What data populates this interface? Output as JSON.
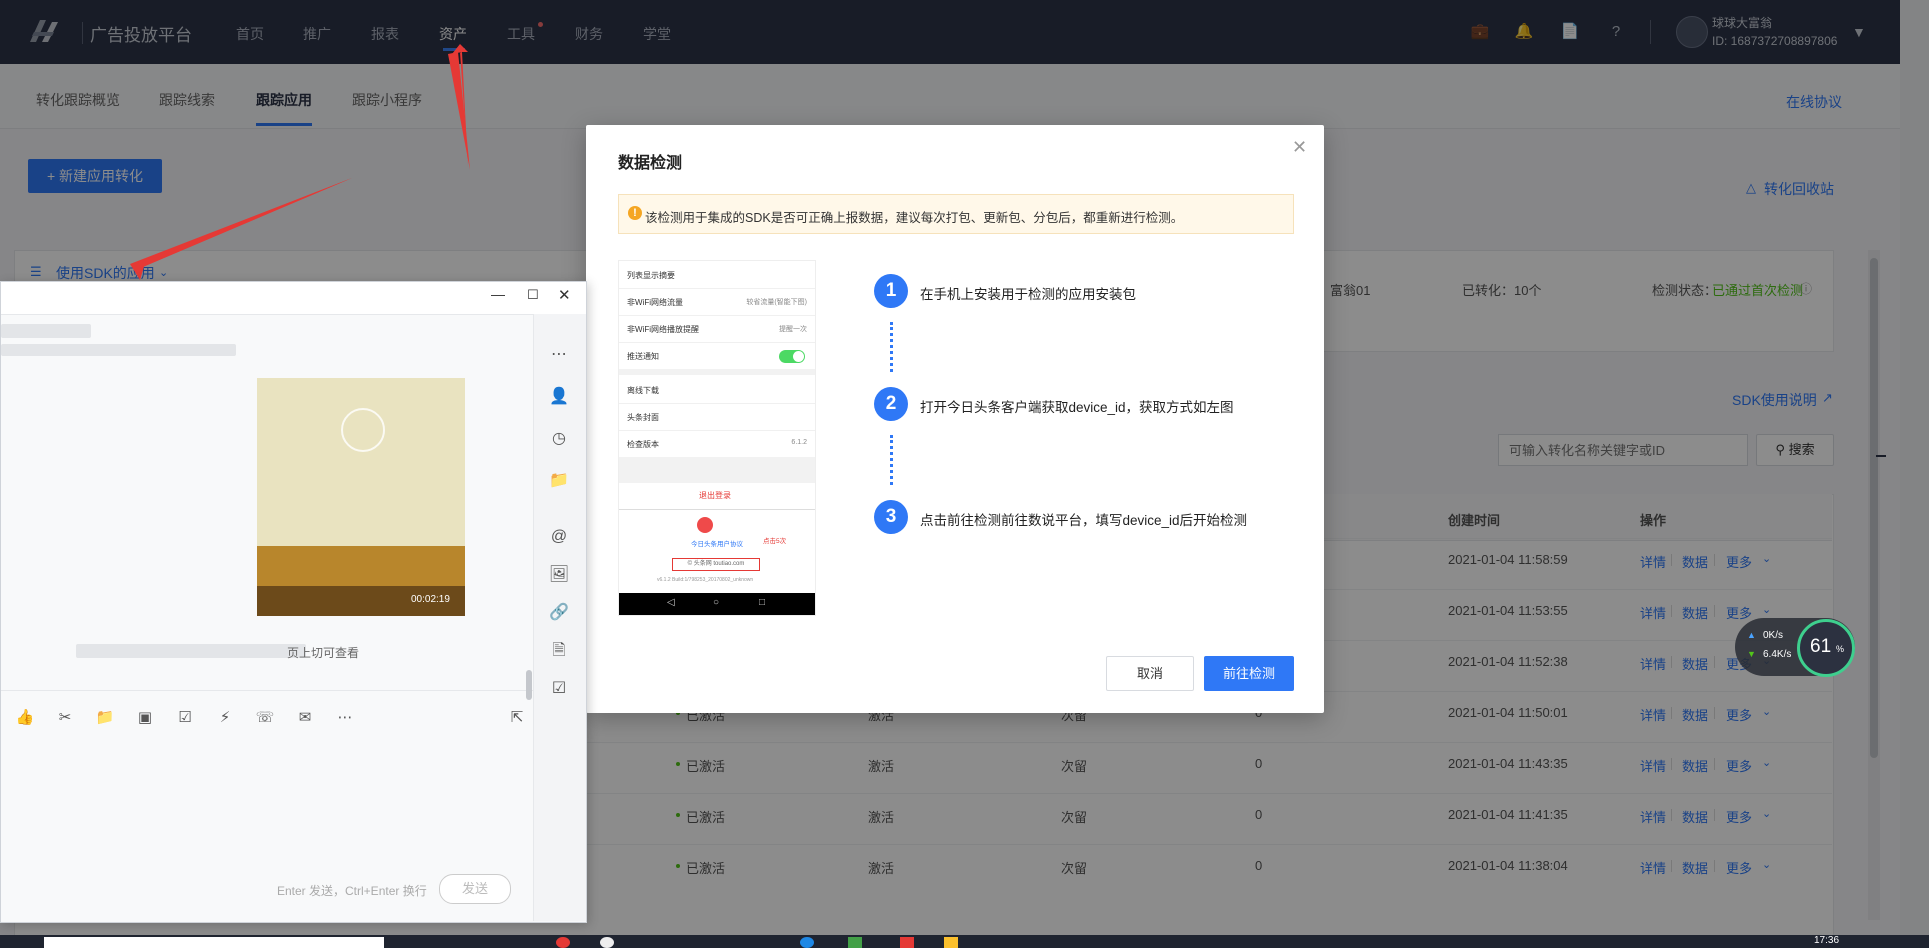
{
  "topnav": {
    "brand": "广告投放平台",
    "items": [
      "首页",
      "推广",
      "报表",
      "资产",
      "工具",
      "财务",
      "学堂"
    ],
    "active": "资产",
    "user": {
      "name": "球球大富翁",
      "id": "ID: 1687372708897806"
    }
  },
  "subnav": {
    "tabs": [
      "转化跟踪概览",
      "跟踪线索",
      "跟踪应用",
      "跟踪小程序"
    ],
    "active": "跟踪应用",
    "right_link": "在线协议"
  },
  "toolbar": {
    "new_button": "+ 新建应用转化",
    "recycle_link": "转化回收站",
    "sdk_dropdown": "使用SDK的应用"
  },
  "summary": {
    "creator": "富翁01",
    "converted": "已转化：10个",
    "status_label": "检测状态：",
    "status_value": "已通过首次检测"
  },
  "search": {
    "sdk_doc_link": "SDK使用说明",
    "placeholder": "可输入转化名称关键字或ID",
    "button": "搜索"
  },
  "table": {
    "headers": {
      "created": "创建时间",
      "ops": "操作"
    },
    "ops": [
      "详情",
      "数据",
      "更多"
    ],
    "rows": [
      {
        "status": "",
        "type": "",
        "freq": "",
        "count": "",
        "time": "2021-01-04 11:58:59"
      },
      {
        "status": "",
        "type": "",
        "freq": "",
        "count": "",
        "time": "2021-01-04 11:53:55"
      },
      {
        "status": "",
        "type": "",
        "freq": "",
        "count": "",
        "time": "2021-01-04 11:52:38"
      },
      {
        "status": "已激活",
        "type": "激活",
        "freq": "次留",
        "count": "0",
        "time": "2021-01-04 11:50:01"
      },
      {
        "status": "已激活",
        "type": "激活",
        "freq": "次留",
        "count": "0",
        "time": "2021-01-04 11:43:35"
      },
      {
        "status": "已激活",
        "type": "激活",
        "freq": "次留",
        "count": "0",
        "time": "2021-01-04 11:41:35"
      },
      {
        "status": "已激活",
        "type": "激活",
        "freq": "次留",
        "count": "0",
        "time": "2021-01-04 11:38:04"
      }
    ]
  },
  "modal": {
    "title": "数据检测",
    "notice": "该检测用于集成的SDK是否可正确上报数据，建议每次打包、更新包、分包后，都重新进行检测。",
    "steps": [
      {
        "num": "1",
        "text": "在手机上安装用于检测的应用安装包"
      },
      {
        "num": "2",
        "text": "打开今日头条客户端获取device_id，获取方式如左图"
      },
      {
        "num": "3",
        "text": "点击前往检测前往数说平台，填写device_id后开始检测"
      }
    ],
    "cancel": "取消",
    "confirm": "前往检测",
    "phone": {
      "rows": [
        {
          "label": "列表显示摘要",
          "value": ""
        },
        {
          "label": "非WiFi网络流量",
          "value": "较省流量(智能下图)"
        },
        {
          "label": "非WiFi网络播放提醒",
          "value": "提醒一次"
        },
        {
          "label": "推送通知",
          "value": ""
        },
        {
          "label": "离线下载",
          "value": ""
        },
        {
          "label": "头条封面",
          "value": ""
        },
        {
          "label": "检查版本",
          "value": "6.1.2"
        }
      ],
      "logout": "退出登录",
      "protocol": "今日头条用户协议",
      "tap_hint": "点击5次",
      "url_box": "© 头条网 toutiao.com",
      "build": "v6.1.2 Build:1/798253_20170802_unknown"
    }
  },
  "chat": {
    "input_hint": "Enter 发送，Ctrl+Enter 换行",
    "send": "发送",
    "preview_text": "页上切可查看",
    "video_duration": "00:02:19"
  },
  "speed": {
    "up": "0K/s",
    "down": "6.4K/s",
    "percent": "61",
    "percent_unit": "%"
  },
  "taskbar": {
    "clock": "17:36"
  },
  "colors": {
    "accent": "#2f78f6",
    "nav_bg": "#2c3447",
    "success": "#52c41a"
  }
}
